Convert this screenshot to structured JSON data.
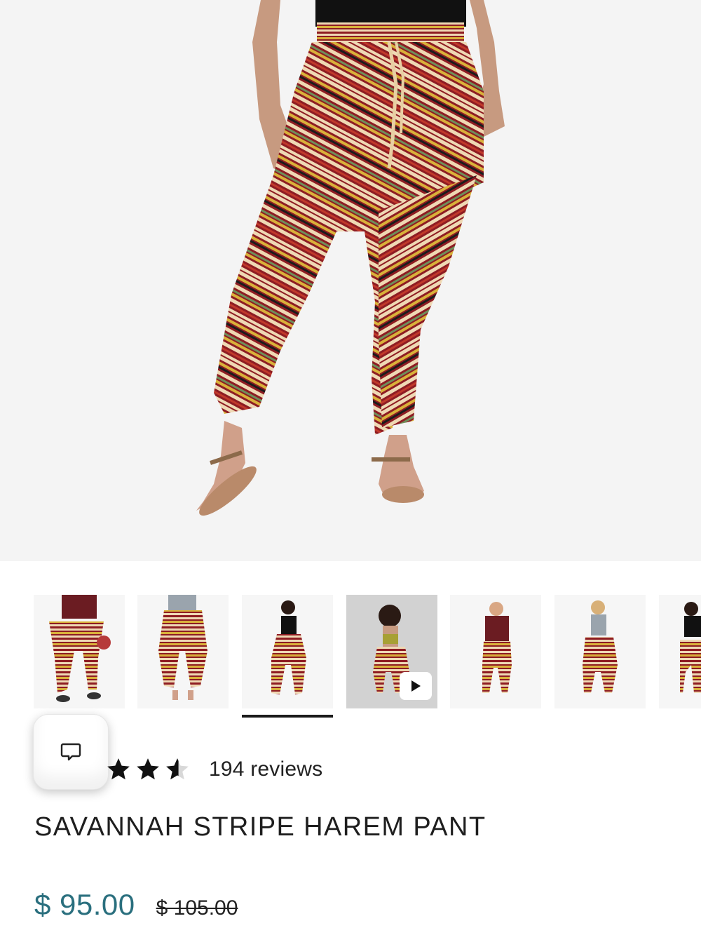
{
  "product": {
    "title": "SAVANNAH STRIPE HAREM PANT",
    "price": "$ 95.00",
    "compare_price": "$ 105.00",
    "rating": 3.5,
    "rating_max": 5,
    "reviews_label": "194 reviews"
  },
  "gallery": {
    "thumbnails": [
      {
        "kind": "image",
        "name": "front-male"
      },
      {
        "kind": "image",
        "name": "back-female"
      },
      {
        "kind": "image",
        "name": "front-female-selected"
      },
      {
        "kind": "video",
        "name": "video"
      },
      {
        "kind": "image",
        "name": "front-male-2"
      },
      {
        "kind": "image",
        "name": "back-female-2"
      },
      {
        "kind": "image",
        "name": "partial"
      }
    ],
    "selected_index": 2
  },
  "colors": {
    "price": "#2a6f7e",
    "stripe_red": "#8e1c23",
    "stripe_yellow": "#d9b13a",
    "stripe_cream": "#efd9b4",
    "stripe_green": "#6f8f5a"
  },
  "icons": {
    "chat": "chat-bubble-icon",
    "play": "play-icon",
    "star": "star-icon"
  }
}
